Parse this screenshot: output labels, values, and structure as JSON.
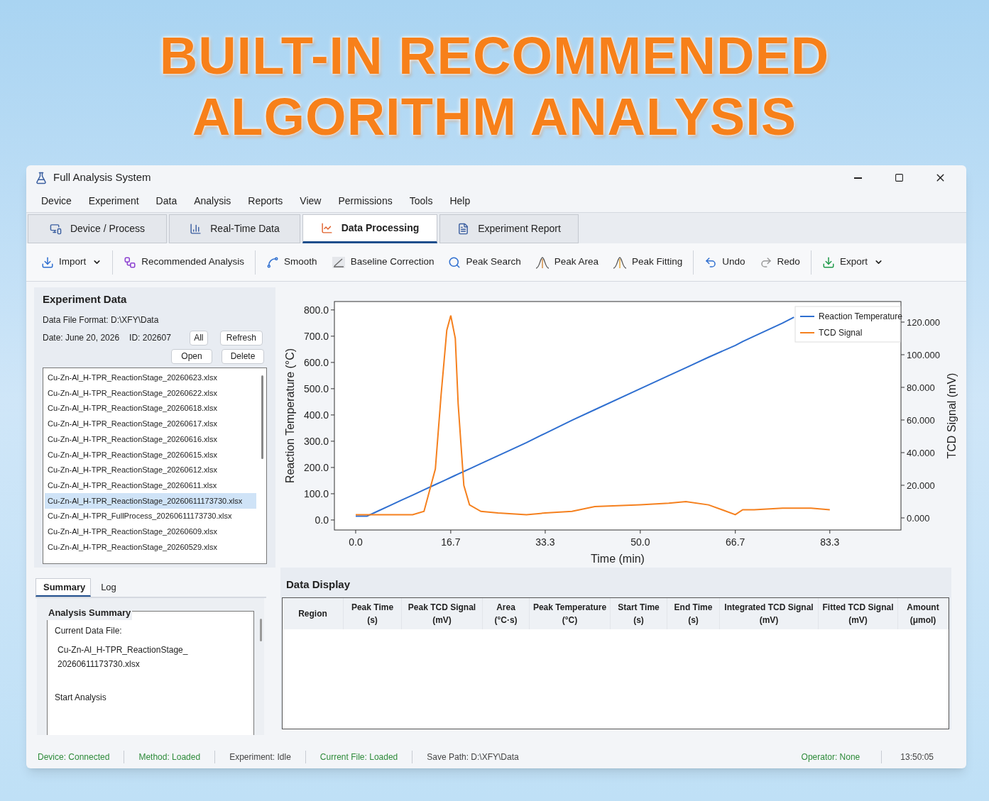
{
  "banner": {
    "lines": [
      "BUILT-IN RECOMMENDED",
      "ALGORITHM ANALYSIS"
    ]
  },
  "window": {
    "title": "Full Analysis System"
  },
  "menu": [
    "Device",
    "Experiment",
    "Data",
    "Analysis",
    "Reports",
    "View",
    "Permissions",
    "Tools",
    "Help"
  ],
  "tabs": [
    {
      "label": "Device / Process",
      "selected": false
    },
    {
      "label": "Real-Time Data",
      "selected": false
    },
    {
      "label": "Data Processing",
      "selected": true
    },
    {
      "label": "Experiment Report",
      "selected": false
    }
  ],
  "toolbar": [
    [
      {
        "label": "Import",
        "dropdown": true
      }
    ],
    [
      {
        "label": "Recommended Analysis",
        "dropdown": false
      }
    ],
    [
      {
        "label": "Smooth",
        "dropdown": false
      },
      {
        "label": "Baseline Correction",
        "dropdown": false
      },
      {
        "label": "Peak Search",
        "dropdown": false
      },
      {
        "label": "Peak Area",
        "dropdown": false
      },
      {
        "label": "Peak Fitting",
        "dropdown": false
      }
    ],
    [
      {
        "label": "Undo",
        "dropdown": false
      },
      {
        "label": "Redo",
        "dropdown": false
      }
    ],
    [
      {
        "label": "Export",
        "dropdown": true
      }
    ]
  ],
  "experiment_data": {
    "title": "Experiment Data",
    "file_format": "Data File Format:  D:\\XFY\\Data",
    "date": "Date:  June 20, 2026",
    "id": "ID:  202607",
    "buttons": [
      "All",
      "Refresh",
      "Open",
      "Delete"
    ],
    "files": [
      {
        "name": "Cu-Zn-Al_H-TPR_ReactionStage_20260623.xlsx",
        "selected": false
      },
      {
        "name": "Cu-Zn-Al_H-TPR_ReactionStage_20260622.xlsx",
        "selected": false
      },
      {
        "name": "Cu-Zn-Al_H-TPR_ReactionStage_20260618.xlsx",
        "selected": false
      },
      {
        "name": "Cu-Zn-Al_H-TPR_ReactionStage_20260617.xlsx",
        "selected": false
      },
      {
        "name": "Cu-Zn-Al_H-TPR_ReactionStage_20260616.xlsx",
        "selected": false
      },
      {
        "name": "Cu-Zn-Al_H-TPR_ReactionStage_20260615.xlsx",
        "selected": false
      },
      {
        "name": "Cu-Zn-Al_H-TPR_ReactionStage_20260612.xlsx",
        "selected": false
      },
      {
        "name": "Cu-Zn-Al_H-TPR_ReactionStage_20260611.xlsx",
        "selected": false
      },
      {
        "name": "Cu-Zn-Al_H-TPR_ReactionStage_20260611173730.xlsx",
        "selected": true
      },
      {
        "name": "Cu-Zn-Al_H-TPR_FullProcess_20260611173730.xlsx",
        "selected": false
      },
      {
        "name": "Cu-Zn-Al_H-TPR_ReactionStage_20260609.xlsx",
        "selected": false
      },
      {
        "name": "Cu-Zn-Al_H-TPR_ReactionStage_20260529.xlsx",
        "selected": false
      }
    ]
  },
  "bottom_tabs": [
    {
      "label": "Summary",
      "selected": true
    },
    {
      "label": "Log",
      "selected": false
    }
  ],
  "summary": {
    "title": "Analysis Summary",
    "label": "Current Data File:",
    "file_lines": [
      "Cu-Zn-Al_H-TPR_ReactionStage_",
      "20260611173730.xlsx"
    ],
    "action": "Start Analysis"
  },
  "chart": {
    "chart_data": {
      "type": "line",
      "legend": "upper right",
      "xlabel": "Time (min)",
      "ylabel": "Reaction Temperature (°C)",
      "y2label": "TCD Signal (mV)",
      "x": [
        0,
        2,
        4,
        6,
        8,
        10,
        12,
        14,
        15,
        16,
        16.7,
        17.5,
        18,
        19,
        20,
        22,
        25,
        30,
        33.3,
        38,
        42,
        50,
        55,
        58,
        62,
        66.7,
        68,
        70,
        75,
        77,
        80,
        83.3
      ],
      "series": [
        {
          "name": "Reaction Temperature",
          "color": "#2f6fd0",
          "values": [
            15,
            15,
            35,
            55,
            75,
            95,
            115,
            135,
            145,
            155,
            162,
            170,
            175,
            185,
            195,
            215,
            245,
            295,
            330,
            380,
            420,
            500,
            550,
            580,
            620,
            665,
            680,
            700,
            750,
            772,
            null,
            null
          ]
        },
        {
          "name": "TCD Signal",
          "color": "#f5801e",
          "axis": "y2",
          "values": [
            2,
            2,
            2,
            2,
            2,
            2,
            4,
            30,
            75,
            115,
            124,
            110,
            70,
            20,
            8,
            4,
            3,
            2,
            3,
            4,
            7,
            8,
            9,
            10,
            8,
            2,
            5,
            5,
            6,
            6,
            6,
            5
          ]
        }
      ],
      "xlim": [
        -3.74,
        95.8
      ],
      "ylim": [
        -38,
        832
      ],
      "y2lim": [
        -7.4,
        132.6
      ],
      "xticks": [
        {
          "value": 0,
          "label": "0.0"
        },
        {
          "value": 16.7,
          "label": "16.7"
        },
        {
          "value": 33.3,
          "label": "33.3"
        },
        {
          "value": 50,
          "label": "50.0"
        },
        {
          "value": 66.7,
          "label": "66.7"
        },
        {
          "value": 83.3,
          "label": "83.3"
        }
      ],
      "yticks": [
        {
          "value": 0,
          "label": "0.0"
        },
        {
          "value": 100,
          "label": "100.0"
        },
        {
          "value": 200,
          "label": "200.0"
        },
        {
          "value": 300,
          "label": "300.0"
        },
        {
          "value": 400,
          "label": "400.0"
        },
        {
          "value": 500,
          "label": "500.0"
        },
        {
          "value": 600,
          "label": "600.0"
        },
        {
          "value": 700,
          "label": "700.0"
        },
        {
          "value": 800,
          "label": "800.0"
        }
      ],
      "y2ticks": [
        {
          "value": 0,
          "label": "0.000"
        },
        {
          "value": 20,
          "label": "20.000"
        },
        {
          "value": 40,
          "label": "40.000"
        },
        {
          "value": 60,
          "label": "60.000"
        },
        {
          "value": 80,
          "label": "80.000"
        },
        {
          "value": 100,
          "label": "100.000"
        },
        {
          "value": 120,
          "label": "120.000"
        }
      ]
    }
  },
  "data_display": {
    "title": "Data Display",
    "columns": [
      "Region",
      "Peak Time\n(s)",
      "Peak TCD Signal\n(mV)",
      "Area\n(°C·s)",
      "Peak Temperature\n(°C)",
      "Start Time\n(s)",
      "End Time\n(s)",
      "Integrated TCD Signal\n(mV)",
      "Fitted TCD Signal\n(mV)",
      "Amount\n(μmol)"
    ]
  },
  "status_bar": {
    "left": [
      {
        "text": "Device: Connected",
        "color": "#2e8b3a"
      },
      {
        "text": "Method: Loaded",
        "color": "#2e8b3a"
      },
      {
        "text": "Experiment: Idle",
        "color": "#444444"
      },
      {
        "text": "Current File: Loaded",
        "color": "#2e8b3a"
      },
      {
        "text": "Save Path:  D:\\XFY\\Data",
        "color": "#444444"
      }
    ],
    "right": [
      {
        "text": "Operator: None",
        "color": "#2e8b3a"
      },
      {
        "text": "13:50:05",
        "color": "#444444"
      }
    ]
  }
}
